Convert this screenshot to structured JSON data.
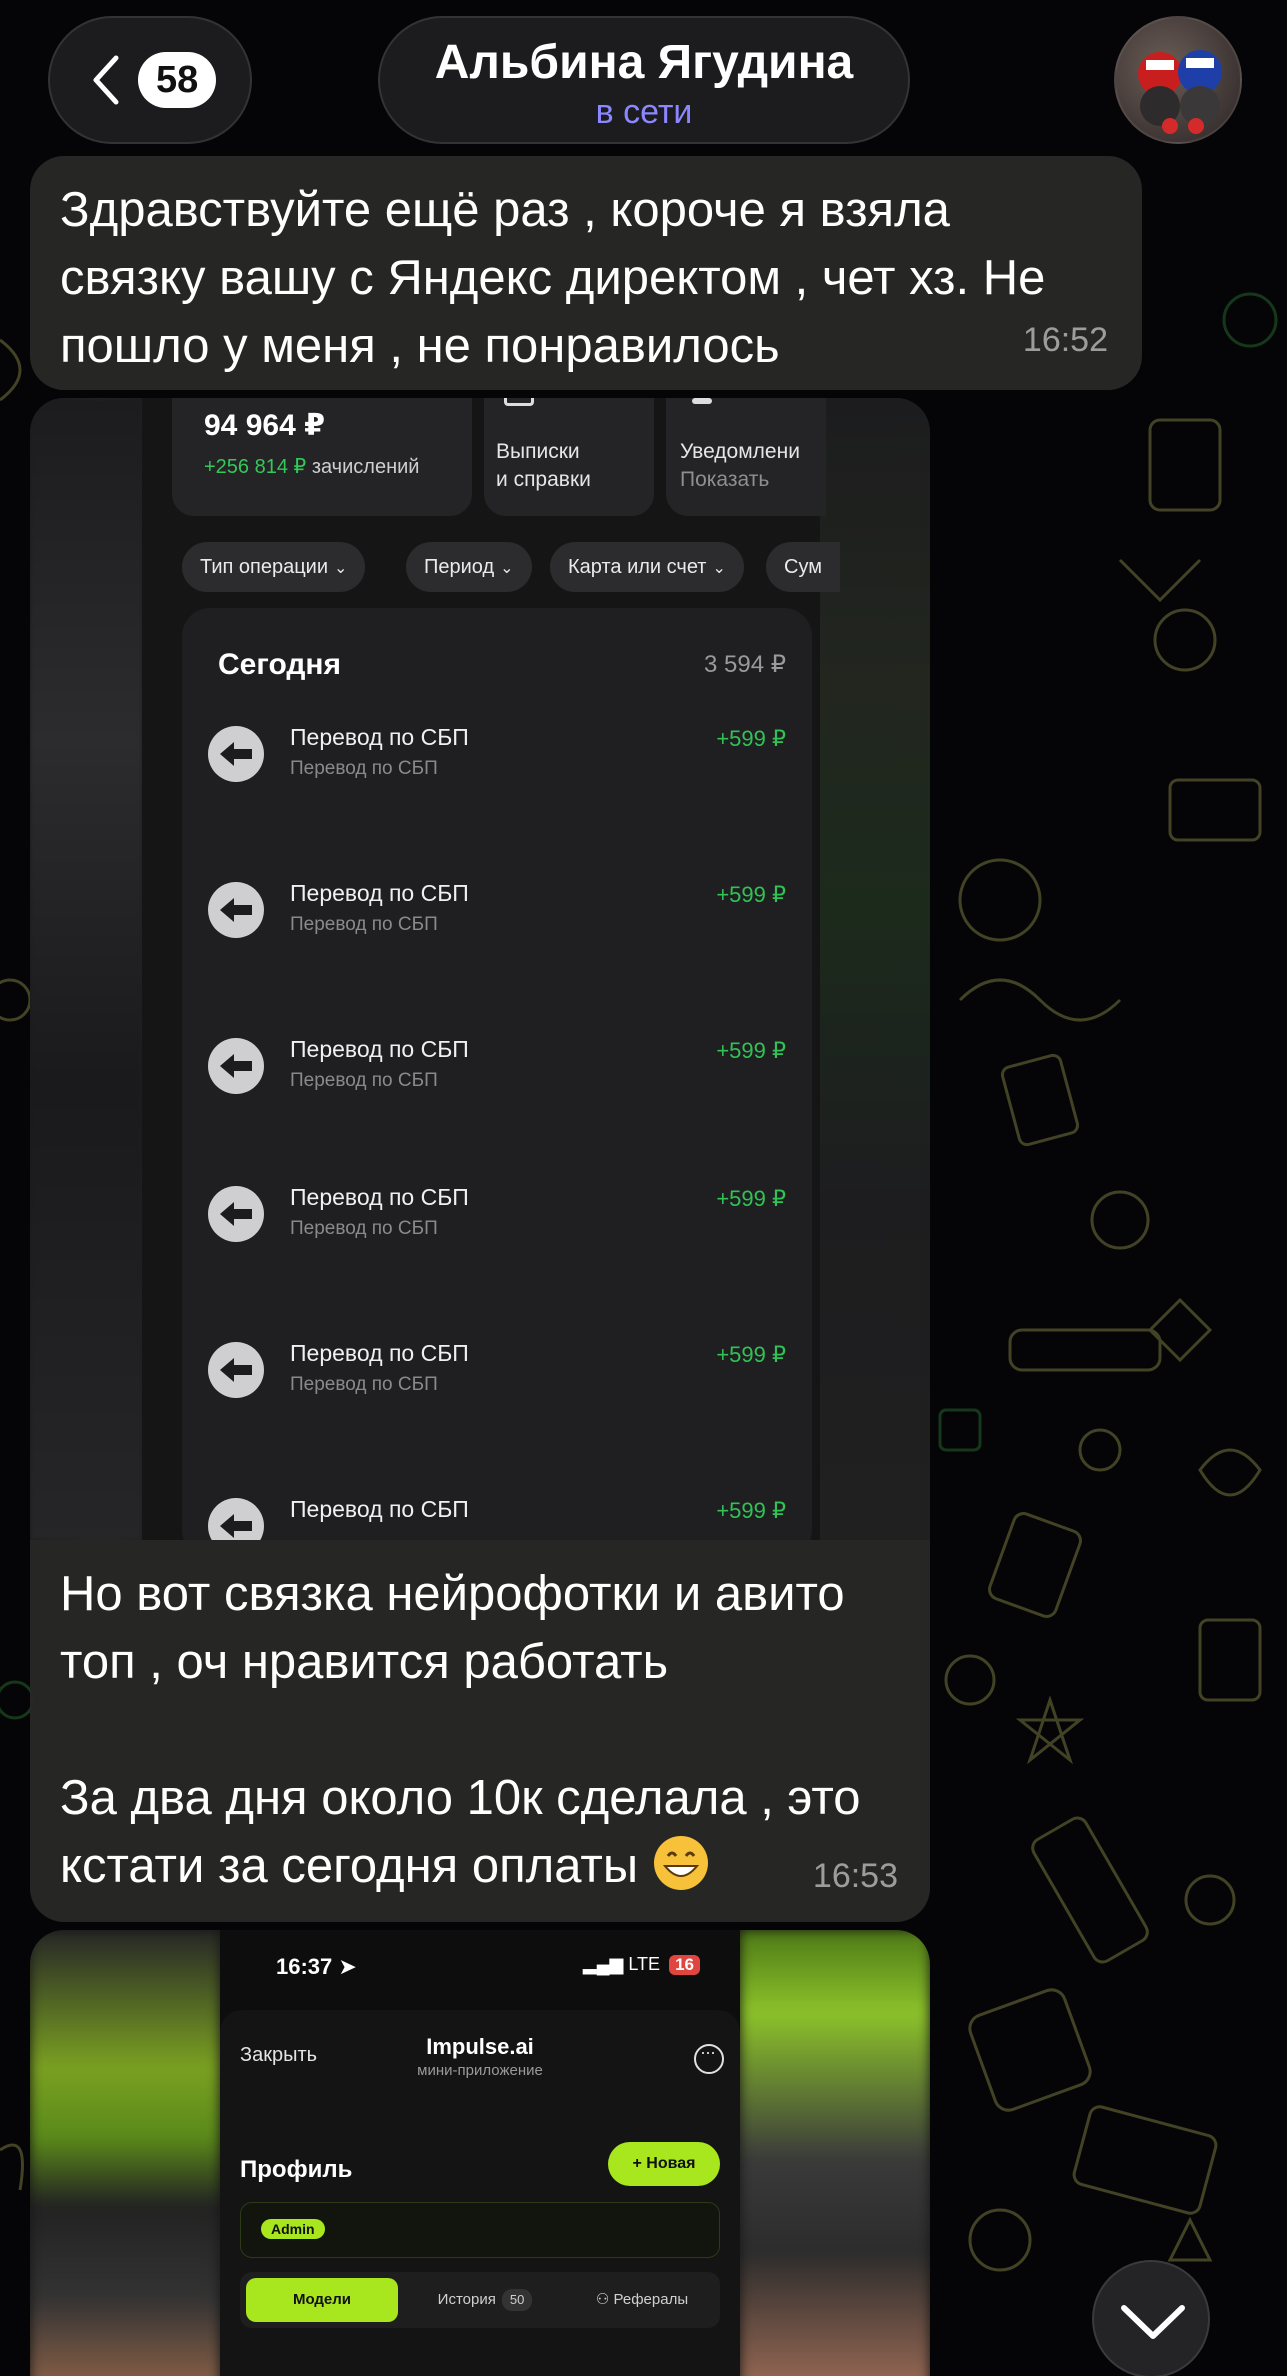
{
  "header": {
    "unread_count": "58",
    "contact_name": "Альбина Ягудина",
    "contact_status": "в сети"
  },
  "messages": [
    {
      "text": "Здравствуйте ещё раз , короче я взяла\nсвязку вашу с Яндекс директом , чет хз. Не\nпошло у меня , не понравилось",
      "time": "16:52"
    },
    {
      "text_1": "Но вот связка нейрофотки и авито\nтоп , оч нравится работать\n\nЗа два дня около 10к сделала , это\nкстати за сегодня оплаты",
      "emoji": "grinning-face",
      "time": "16:53"
    }
  ],
  "photo_1": {
    "balance": "94 964 ₽",
    "credits_amount": "+256 814 ₽",
    "credits_label": "зачислений",
    "tile_statements": "Выписки\nи справки",
    "tile_notifications_title": "Уведомлени",
    "tile_notifications_sub": "Показать",
    "filters": [
      "Тип операции",
      "Период",
      "Карта или счет",
      "Сум"
    ],
    "section_title": "Сегодня",
    "section_total": "3 594 ₽",
    "operations": [
      {
        "title": "Перевод по СБП",
        "subtitle": "Перевод по СБП",
        "amount": "+599 ₽"
      },
      {
        "title": "Перевод по СБП",
        "subtitle": "Перевод по СБП",
        "amount": "+599 ₽"
      },
      {
        "title": "Перевод по СБП",
        "subtitle": "Перевод по СБП",
        "amount": "+599 ₽"
      },
      {
        "title": "Перевод по СБП",
        "subtitle": "Перевод по СБП",
        "amount": "+599 ₽"
      },
      {
        "title": "Перевод по СБП",
        "subtitle": "Перевод по СБП",
        "amount": "+599 ₽"
      },
      {
        "title": "Перевод по СБП",
        "subtitle": "",
        "amount": "+599 ₽"
      }
    ]
  },
  "photo_2": {
    "status_time": "16:37",
    "network": "LTE",
    "battery": "16",
    "close_label": "Закрыть",
    "app_name": "Impulse.ai",
    "app_subtitle": "мини-приложение",
    "profile_title": "Профиль",
    "new_button": "+ Новая",
    "admin_badge": "Admin",
    "tabs": [
      {
        "label": "Модели",
        "active": true
      },
      {
        "label": "История",
        "count": "50"
      },
      {
        "label": "Рефералы"
      }
    ]
  },
  "colors": {
    "accent_status": "#8b87ff",
    "bubble": "#282826",
    "income_green": "#30c255",
    "impulse_lime": "#a8e61d"
  }
}
